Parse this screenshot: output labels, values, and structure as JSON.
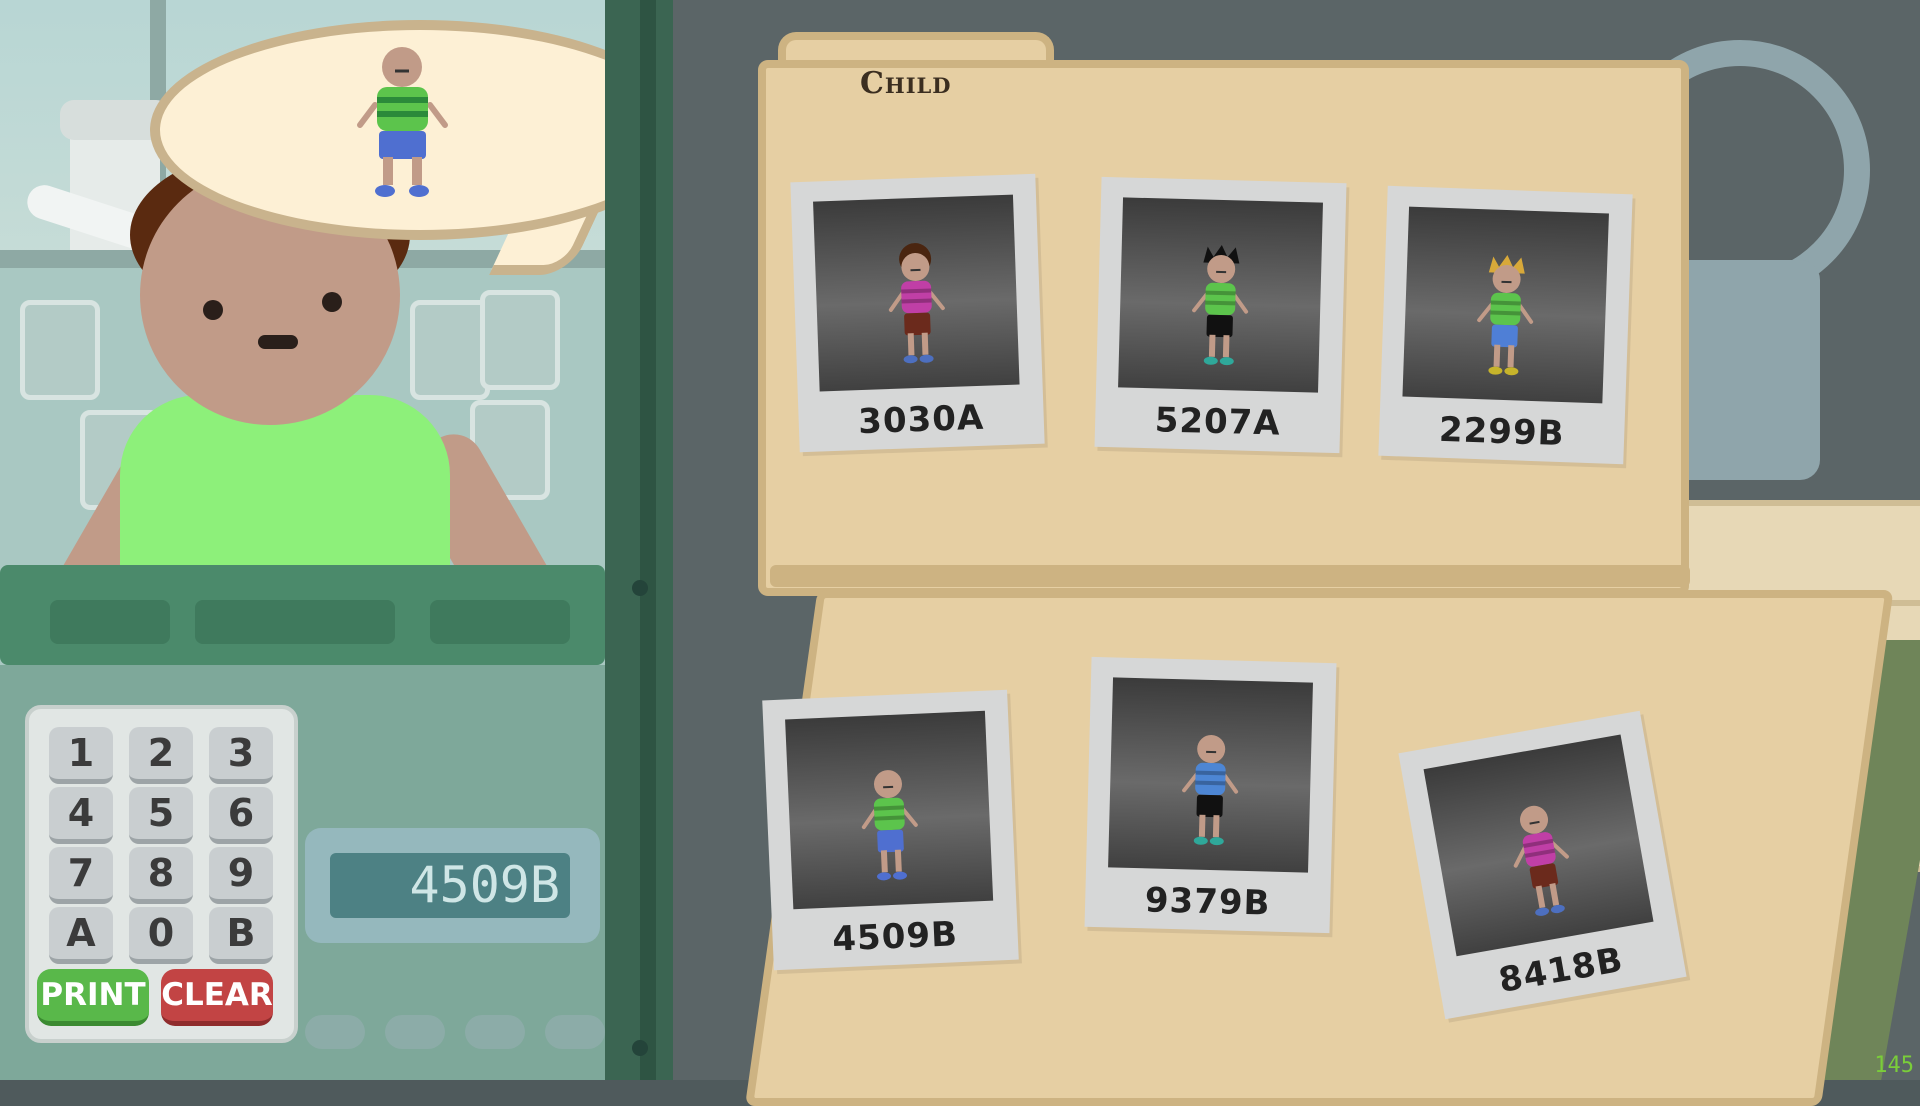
{
  "folder": {
    "title": "Child"
  },
  "keypad": {
    "keys": [
      "1",
      "2",
      "3",
      "4",
      "5",
      "6",
      "7",
      "8",
      "9",
      "A",
      "0",
      "B"
    ],
    "print_label": "PRINT",
    "clear_label": "CLEAR"
  },
  "display": {
    "code": "4509B"
  },
  "photos": [
    {
      "id": "3030A",
      "hair": "curly-brown",
      "shirt": "#c03fa6",
      "pants": "#6b2a1c",
      "shoes": "#4d6fbf"
    },
    {
      "id": "5207A",
      "hair": "spiky-black",
      "shirt": "#5cc44c",
      "pants": "#111111",
      "shoes": "#2fa89a"
    },
    {
      "id": "2299B",
      "hair": "spiky-blond",
      "shirt": "#5cc44c",
      "pants": "#4f7fd6",
      "shoes": "#c7b42b"
    },
    {
      "id": "4509B",
      "hair": "bald",
      "shirt": "#5cc44c",
      "pants": "#4f6fd0",
      "shoes": "#4f6fd0"
    },
    {
      "id": "9379B",
      "hair": "bald",
      "shirt": "#4d86d4",
      "pants": "#111111",
      "shoes": "#2fa89a"
    },
    {
      "id": "8418B",
      "hair": "bald",
      "shirt": "#c03fa6",
      "pants": "#6b2a1c",
      "shoes": "#4d6fbf"
    }
  ],
  "fps": "145",
  "colors": {
    "folder": "#e6cfa3",
    "keypad_print": "#59b84a",
    "keypad_clear": "#c24444",
    "display": "#4d8184"
  }
}
